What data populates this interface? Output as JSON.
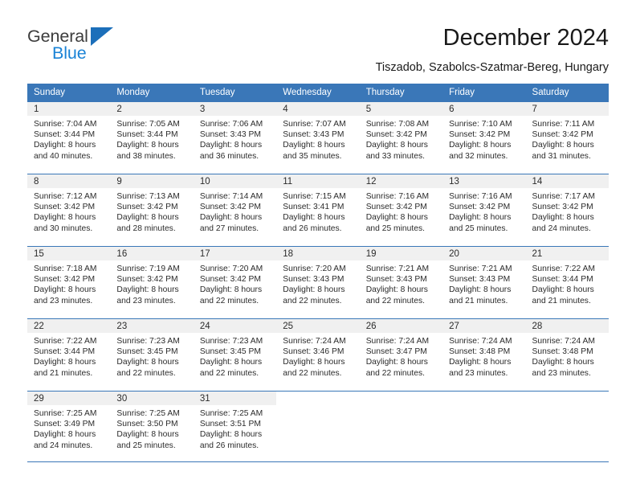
{
  "brand": {
    "name_top": "General",
    "name_bottom": "Blue",
    "accent_color": "#1a83d6",
    "triangle_color": "#1c6fba"
  },
  "header": {
    "title": "December 2024",
    "subtitle": "Tiszadob, Szabolcs-Szatmar-Bereg, Hungary"
  },
  "calendar": {
    "header_bg": "#3a77b8",
    "daynum_bg": "#f0f0f0",
    "weekday_headers": [
      "Sunday",
      "Monday",
      "Tuesday",
      "Wednesday",
      "Thursday",
      "Friday",
      "Saturday"
    ],
    "weeks": [
      [
        {
          "day": "1",
          "sunrise": "Sunrise: 7:04 AM",
          "sunset": "Sunset: 3:44 PM",
          "daylight1": "Daylight: 8 hours",
          "daylight2": "and 40 minutes."
        },
        {
          "day": "2",
          "sunrise": "Sunrise: 7:05 AM",
          "sunset": "Sunset: 3:44 PM",
          "daylight1": "Daylight: 8 hours",
          "daylight2": "and 38 minutes."
        },
        {
          "day": "3",
          "sunrise": "Sunrise: 7:06 AM",
          "sunset": "Sunset: 3:43 PM",
          "daylight1": "Daylight: 8 hours",
          "daylight2": "and 36 minutes."
        },
        {
          "day": "4",
          "sunrise": "Sunrise: 7:07 AM",
          "sunset": "Sunset: 3:43 PM",
          "daylight1": "Daylight: 8 hours",
          "daylight2": "and 35 minutes."
        },
        {
          "day": "5",
          "sunrise": "Sunrise: 7:08 AM",
          "sunset": "Sunset: 3:42 PM",
          "daylight1": "Daylight: 8 hours",
          "daylight2": "and 33 minutes."
        },
        {
          "day": "6",
          "sunrise": "Sunrise: 7:10 AM",
          "sunset": "Sunset: 3:42 PM",
          "daylight1": "Daylight: 8 hours",
          "daylight2": "and 32 minutes."
        },
        {
          "day": "7",
          "sunrise": "Sunrise: 7:11 AM",
          "sunset": "Sunset: 3:42 PM",
          "daylight1": "Daylight: 8 hours",
          "daylight2": "and 31 minutes."
        }
      ],
      [
        {
          "day": "8",
          "sunrise": "Sunrise: 7:12 AM",
          "sunset": "Sunset: 3:42 PM",
          "daylight1": "Daylight: 8 hours",
          "daylight2": "and 30 minutes."
        },
        {
          "day": "9",
          "sunrise": "Sunrise: 7:13 AM",
          "sunset": "Sunset: 3:42 PM",
          "daylight1": "Daylight: 8 hours",
          "daylight2": "and 28 minutes."
        },
        {
          "day": "10",
          "sunrise": "Sunrise: 7:14 AM",
          "sunset": "Sunset: 3:42 PM",
          "daylight1": "Daylight: 8 hours",
          "daylight2": "and 27 minutes."
        },
        {
          "day": "11",
          "sunrise": "Sunrise: 7:15 AM",
          "sunset": "Sunset: 3:41 PM",
          "daylight1": "Daylight: 8 hours",
          "daylight2": "and 26 minutes."
        },
        {
          "day": "12",
          "sunrise": "Sunrise: 7:16 AM",
          "sunset": "Sunset: 3:42 PM",
          "daylight1": "Daylight: 8 hours",
          "daylight2": "and 25 minutes."
        },
        {
          "day": "13",
          "sunrise": "Sunrise: 7:16 AM",
          "sunset": "Sunset: 3:42 PM",
          "daylight1": "Daylight: 8 hours",
          "daylight2": "and 25 minutes."
        },
        {
          "day": "14",
          "sunrise": "Sunrise: 7:17 AM",
          "sunset": "Sunset: 3:42 PM",
          "daylight1": "Daylight: 8 hours",
          "daylight2": "and 24 minutes."
        }
      ],
      [
        {
          "day": "15",
          "sunrise": "Sunrise: 7:18 AM",
          "sunset": "Sunset: 3:42 PM",
          "daylight1": "Daylight: 8 hours",
          "daylight2": "and 23 minutes."
        },
        {
          "day": "16",
          "sunrise": "Sunrise: 7:19 AM",
          "sunset": "Sunset: 3:42 PM",
          "daylight1": "Daylight: 8 hours",
          "daylight2": "and 23 minutes."
        },
        {
          "day": "17",
          "sunrise": "Sunrise: 7:20 AM",
          "sunset": "Sunset: 3:42 PM",
          "daylight1": "Daylight: 8 hours",
          "daylight2": "and 22 minutes."
        },
        {
          "day": "18",
          "sunrise": "Sunrise: 7:20 AM",
          "sunset": "Sunset: 3:43 PM",
          "daylight1": "Daylight: 8 hours",
          "daylight2": "and 22 minutes."
        },
        {
          "day": "19",
          "sunrise": "Sunrise: 7:21 AM",
          "sunset": "Sunset: 3:43 PM",
          "daylight1": "Daylight: 8 hours",
          "daylight2": "and 22 minutes."
        },
        {
          "day": "20",
          "sunrise": "Sunrise: 7:21 AM",
          "sunset": "Sunset: 3:43 PM",
          "daylight1": "Daylight: 8 hours",
          "daylight2": "and 21 minutes."
        },
        {
          "day": "21",
          "sunrise": "Sunrise: 7:22 AM",
          "sunset": "Sunset: 3:44 PM",
          "daylight1": "Daylight: 8 hours",
          "daylight2": "and 21 minutes."
        }
      ],
      [
        {
          "day": "22",
          "sunrise": "Sunrise: 7:22 AM",
          "sunset": "Sunset: 3:44 PM",
          "daylight1": "Daylight: 8 hours",
          "daylight2": "and 21 minutes."
        },
        {
          "day": "23",
          "sunrise": "Sunrise: 7:23 AM",
          "sunset": "Sunset: 3:45 PM",
          "daylight1": "Daylight: 8 hours",
          "daylight2": "and 22 minutes."
        },
        {
          "day": "24",
          "sunrise": "Sunrise: 7:23 AM",
          "sunset": "Sunset: 3:45 PM",
          "daylight1": "Daylight: 8 hours",
          "daylight2": "and 22 minutes."
        },
        {
          "day": "25",
          "sunrise": "Sunrise: 7:24 AM",
          "sunset": "Sunset: 3:46 PM",
          "daylight1": "Daylight: 8 hours",
          "daylight2": "and 22 minutes."
        },
        {
          "day": "26",
          "sunrise": "Sunrise: 7:24 AM",
          "sunset": "Sunset: 3:47 PM",
          "daylight1": "Daylight: 8 hours",
          "daylight2": "and 22 minutes."
        },
        {
          "day": "27",
          "sunrise": "Sunrise: 7:24 AM",
          "sunset": "Sunset: 3:48 PM",
          "daylight1": "Daylight: 8 hours",
          "daylight2": "and 23 minutes."
        },
        {
          "day": "28",
          "sunrise": "Sunrise: 7:24 AM",
          "sunset": "Sunset: 3:48 PM",
          "daylight1": "Daylight: 8 hours",
          "daylight2": "and 23 minutes."
        }
      ],
      [
        {
          "day": "29",
          "sunrise": "Sunrise: 7:25 AM",
          "sunset": "Sunset: 3:49 PM",
          "daylight1": "Daylight: 8 hours",
          "daylight2": "and 24 minutes."
        },
        {
          "day": "30",
          "sunrise": "Sunrise: 7:25 AM",
          "sunset": "Sunset: 3:50 PM",
          "daylight1": "Daylight: 8 hours",
          "daylight2": "and 25 minutes."
        },
        {
          "day": "31",
          "sunrise": "Sunrise: 7:25 AM",
          "sunset": "Sunset: 3:51 PM",
          "daylight1": "Daylight: 8 hours",
          "daylight2": "and 26 minutes."
        },
        {
          "day": "",
          "sunrise": "",
          "sunset": "",
          "daylight1": "",
          "daylight2": ""
        },
        {
          "day": "",
          "sunrise": "",
          "sunset": "",
          "daylight1": "",
          "daylight2": ""
        },
        {
          "day": "",
          "sunrise": "",
          "sunset": "",
          "daylight1": "",
          "daylight2": ""
        },
        {
          "day": "",
          "sunrise": "",
          "sunset": "",
          "daylight1": "",
          "daylight2": ""
        }
      ]
    ]
  }
}
